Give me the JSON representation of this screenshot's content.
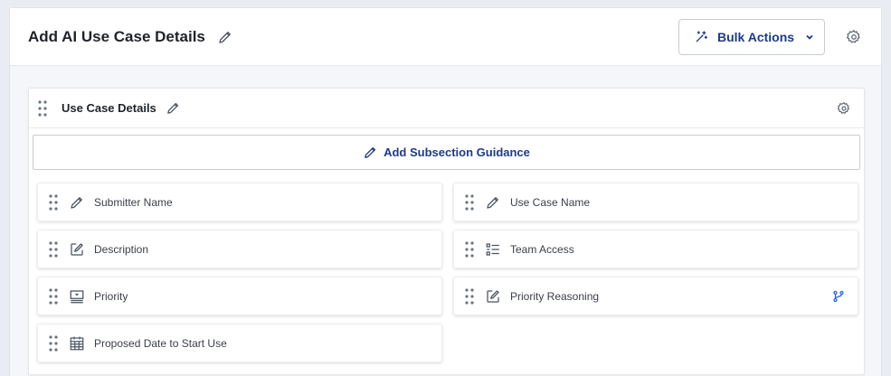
{
  "header": {
    "title": "Add AI Use Case Details",
    "bulk_actions_label": "Bulk Actions"
  },
  "section": {
    "title": "Use Case Details",
    "guidance_label": "Add Subsection Guidance",
    "fields": [
      {
        "label": "Submitter Name",
        "icon": "pencil-icon"
      },
      {
        "label": "Use Case Name",
        "icon": "pencil-icon"
      },
      {
        "label": "Description",
        "icon": "edit-box-icon"
      },
      {
        "label": "Team Access",
        "icon": "list-icon"
      },
      {
        "label": "Priority",
        "icon": "dropdown-icon"
      },
      {
        "label": "Priority Reasoning",
        "icon": "edit-box-icon"
      },
      {
        "label": "Proposed Date to Start Use",
        "icon": "calendar-icon"
      }
    ]
  },
  "colors": {
    "accent": "#1e3a8a",
    "background": "#e9edf3",
    "branch": "#2563eb"
  }
}
